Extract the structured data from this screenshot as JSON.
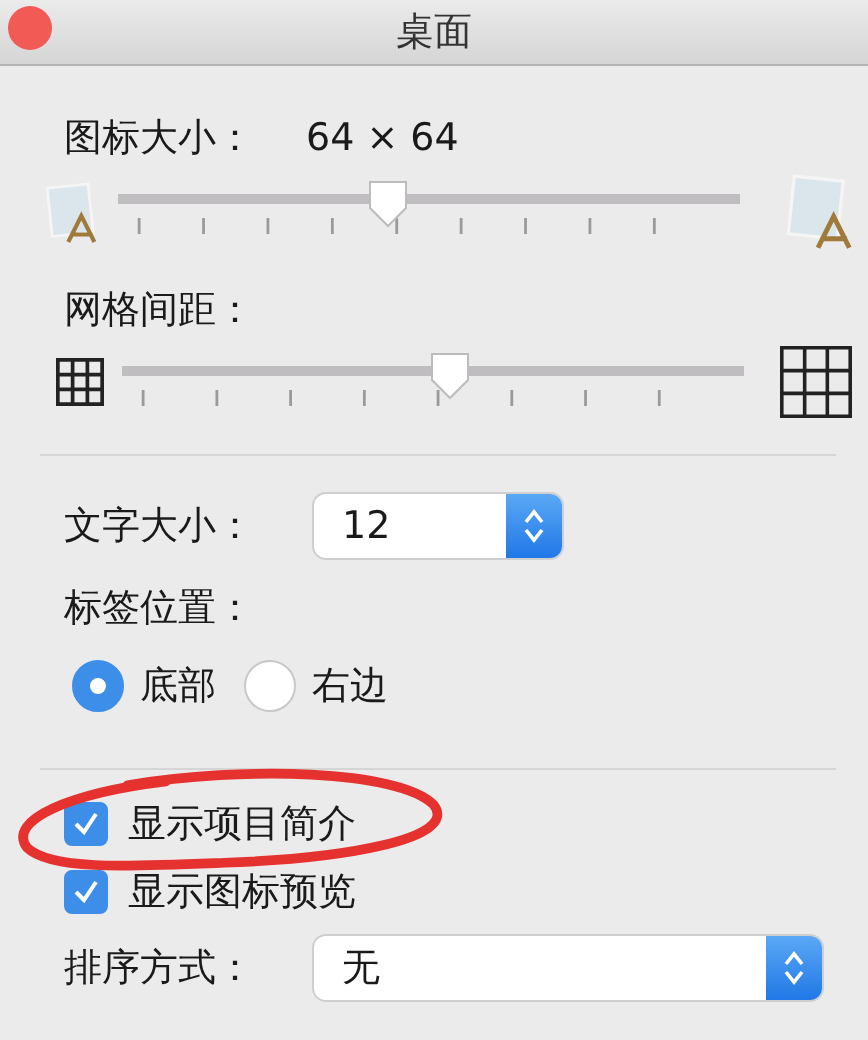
{
  "window": {
    "title": "桌面"
  },
  "icon_size": {
    "label": "图标大小：",
    "value": "64 × 64",
    "level": 0.43
  },
  "grid_spacing": {
    "label": "网格间距：",
    "level": 0.53
  },
  "text_size": {
    "label": "文字大小：",
    "value": "12"
  },
  "label_position": {
    "label": "标签位置：",
    "options": [
      {
        "label": "底部",
        "selected": true
      },
      {
        "label": "右边",
        "selected": false
      }
    ]
  },
  "checkboxes": [
    {
      "label": "显示项目简介",
      "checked": true
    },
    {
      "label": "显示图标预览",
      "checked": true
    }
  ],
  "sort_by": {
    "label": "排序方式：",
    "value": "无"
  }
}
